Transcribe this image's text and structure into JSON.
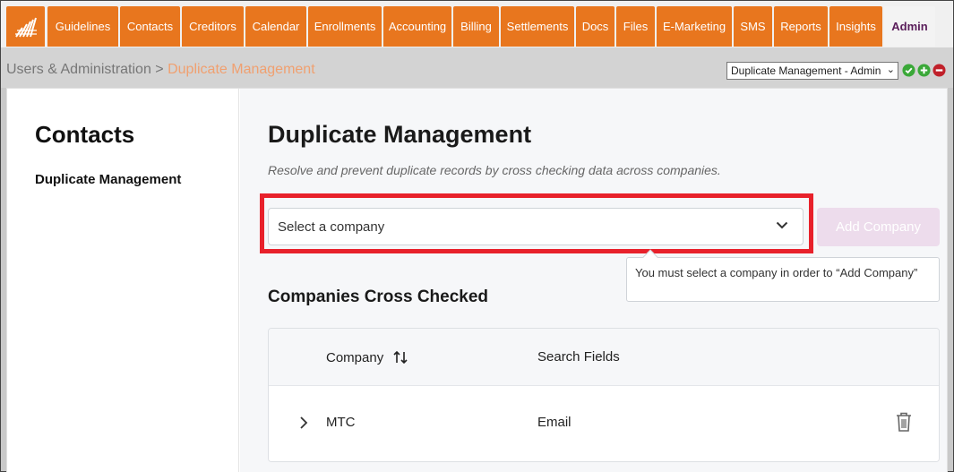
{
  "nav": {
    "tabs": [
      {
        "label": "Guidelines"
      },
      {
        "label": "Contacts"
      },
      {
        "label": "Creditors"
      },
      {
        "label": "Calendar"
      },
      {
        "label": "Enrollments"
      },
      {
        "label": "Accounting"
      },
      {
        "label": "Billing"
      },
      {
        "label": "Settlements"
      },
      {
        "label": "Docs"
      },
      {
        "label": "Files"
      },
      {
        "label": "E-Marketing"
      },
      {
        "label": "SMS"
      },
      {
        "label": "Reports"
      },
      {
        "label": "Insights"
      },
      {
        "label": "Admin"
      }
    ],
    "active_tab": "Admin"
  },
  "breadcrumb": {
    "parent": "Users & Administration",
    "separator": ">",
    "current": "Duplicate Management"
  },
  "view_select": {
    "value": "Duplicate Management - Admin"
  },
  "sidebar": {
    "title": "Contacts",
    "item": "Duplicate Management"
  },
  "main": {
    "title": "Duplicate Management",
    "description": "Resolve and prevent duplicate records by cross checking data across companies.",
    "company_select": {
      "placeholder": "Select a company"
    },
    "add_button": "Add Company",
    "tooltip": "You must select a company in order to “Add Company”",
    "section_title": "Companies Cross Checked",
    "table": {
      "columns": [
        "Company",
        "Search Fields"
      ],
      "rows": [
        {
          "company": "MTC",
          "search_fields": "Email"
        }
      ]
    }
  },
  "colors": {
    "nav_orange": "#e8761e",
    "active_tab_text": "#5a1d5a",
    "highlight_red": "#e8212b",
    "add_button_disabled": "#eddcec",
    "ok_green": "#3aa838",
    "remove_red": "#c0202a"
  }
}
